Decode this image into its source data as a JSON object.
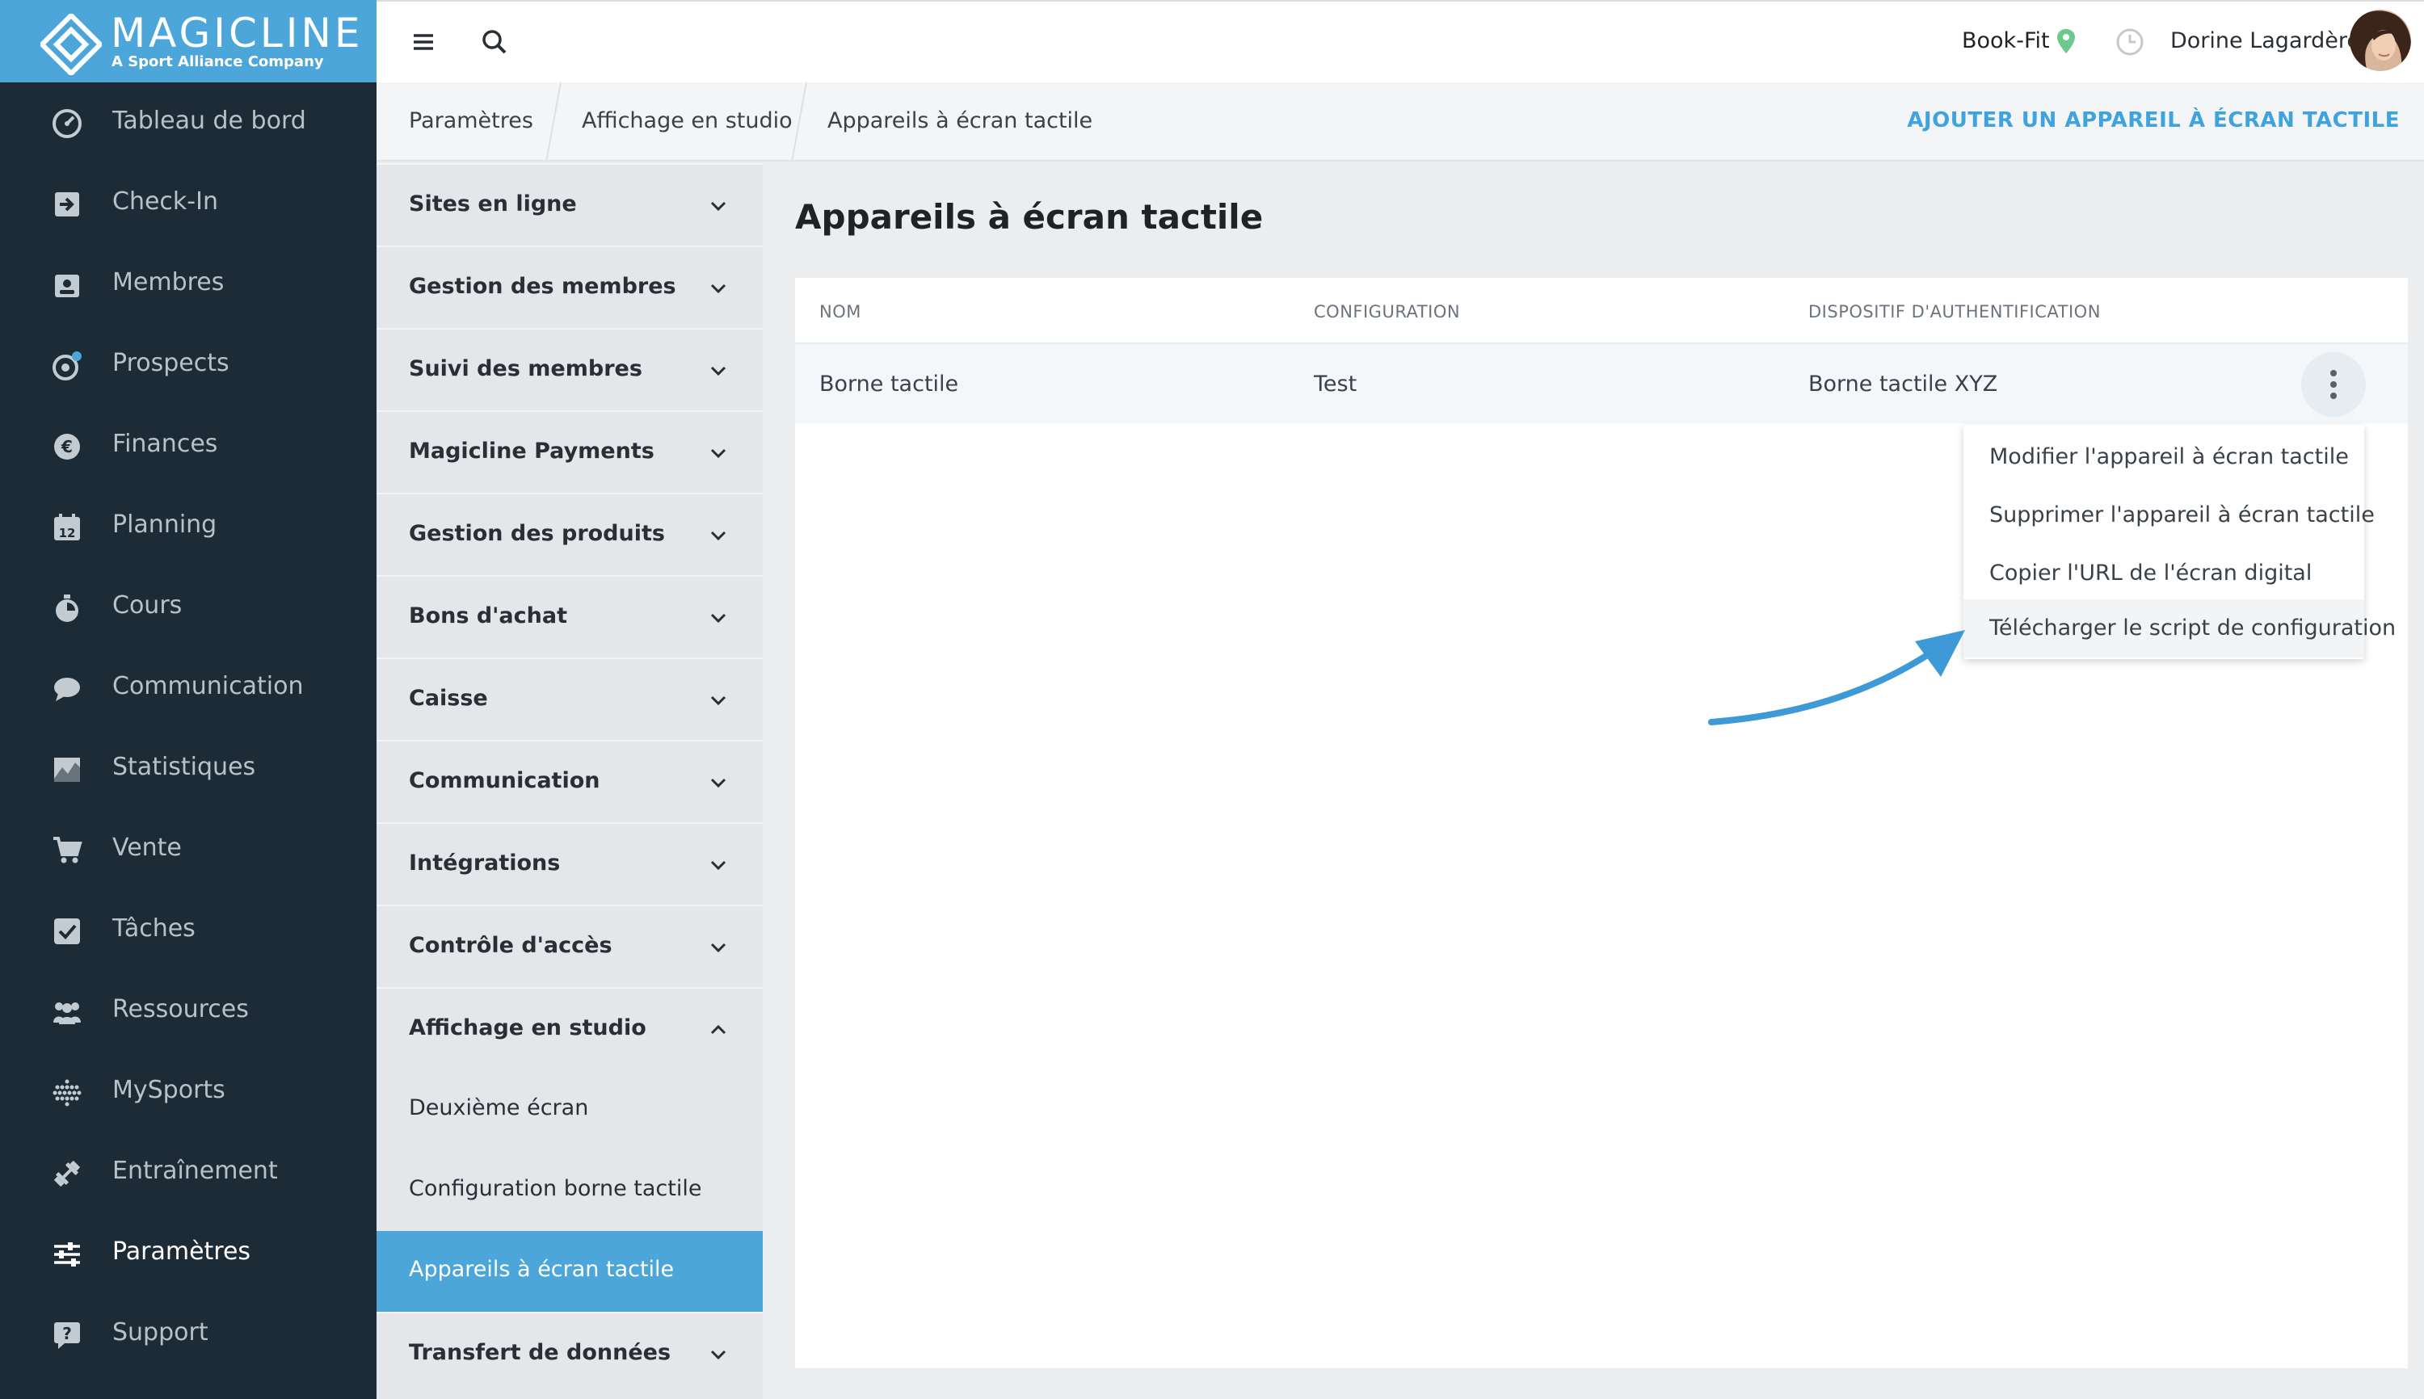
{
  "brand": {
    "name": "MAGICLINE",
    "tagline": "A Sport Alliance Company",
    "color": "#4ca6da"
  },
  "nav": {
    "items": [
      {
        "label": "Tableau de bord",
        "icon": "dashboard-icon"
      },
      {
        "label": "Check-In",
        "icon": "check-in-icon"
      },
      {
        "label": "Membres",
        "icon": "members-icon"
      },
      {
        "label": "Prospects",
        "icon": "prospects-icon"
      },
      {
        "label": "Finances",
        "icon": "finances-icon"
      },
      {
        "label": "Planning",
        "icon": "calendar-icon",
        "day": "12"
      },
      {
        "label": "Cours",
        "icon": "stopwatch-icon"
      },
      {
        "label": "Communication",
        "icon": "chat-icon"
      },
      {
        "label": "Statistiques",
        "icon": "statistics-icon"
      },
      {
        "label": "Vente",
        "icon": "cart-icon"
      },
      {
        "label": "Tâches",
        "icon": "tasks-icon"
      },
      {
        "label": "Ressources",
        "icon": "resources-icon"
      },
      {
        "label": "MySports",
        "icon": "mysports-icon"
      },
      {
        "label": "Entraînement",
        "icon": "dumbbell-icon"
      },
      {
        "label": "Paramètres",
        "icon": "settings-sliders-icon",
        "active": true
      },
      {
        "label": "Support",
        "icon": "support-icon"
      }
    ]
  },
  "topbar": {
    "studio": "Book-Fit",
    "user": "Dorine Lagardère",
    "icons": [
      "hamburger-menu-icon",
      "search-icon",
      "location-pin-icon",
      "clock-icon"
    ]
  },
  "breadcrumb": [
    "Paramètres",
    "Affichage en studio",
    "Appareils à écran tactile"
  ],
  "actions": {
    "add_device": "AJOUTER UN APPAREIL À ÉCRAN TACTILE"
  },
  "submenu": {
    "items": [
      {
        "label": "Sites en ligne"
      },
      {
        "label": "Gestion des membres"
      },
      {
        "label": "Suivi des membres"
      },
      {
        "label": "Magicline Payments"
      },
      {
        "label": "Gestion des produits"
      },
      {
        "label": "Bons d'achat"
      },
      {
        "label": "Caisse"
      },
      {
        "label": "Communication"
      },
      {
        "label": "Intégrations"
      },
      {
        "label": "Contrôle d'accès"
      },
      {
        "label": "Affichage en studio",
        "expanded": true
      }
    ],
    "children": [
      {
        "label": "Deuxième écran"
      },
      {
        "label": "Configuration borne tactile"
      },
      {
        "label": "Appareils à écran tactile",
        "active": true
      }
    ],
    "after": {
      "label": "Transfert de données"
    }
  },
  "main": {
    "title": "Appareils à écran tactile",
    "table": {
      "headers": [
        "NOM",
        "CONFIGURATION",
        "DISPOSITIF D'AUTHENTIFICATION"
      ],
      "rows": [
        {
          "name": "Borne tactile",
          "configuration": "Test",
          "auth_device": "Borne tactile XYZ"
        }
      ]
    },
    "context_menu": [
      "Modifier l'appareil à écran tactile",
      "Supprimer l'appareil à écran tactile",
      "Copier l'URL de l'écran digital",
      "Télécharger le script de configuration"
    ],
    "highlighted_menu_item": "Télécharger le script de configuration"
  },
  "colors": {
    "sidebar": "#1d2b36",
    "accent": "#4ca6da",
    "link": "#3ea3df",
    "arrow": "#3d9ad6",
    "pin": "#6cc98b"
  }
}
